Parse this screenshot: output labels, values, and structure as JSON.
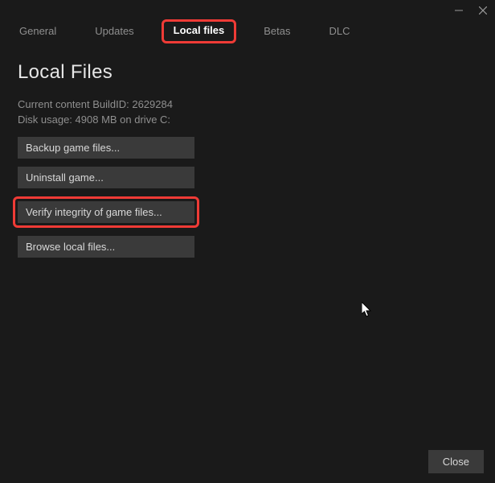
{
  "window": {
    "minimize_icon": "minimize-icon",
    "close_icon": "close-icon"
  },
  "tabs": {
    "general": "General",
    "updates": "Updates",
    "local_files": "Local files",
    "betas": "Betas",
    "dlc": "DLC"
  },
  "page": {
    "title": "Local Files",
    "build_line": "Current content BuildID: 2629284",
    "disk_line": "Disk usage: 4908 MB on drive C:"
  },
  "buttons": {
    "backup": "Backup game files...",
    "uninstall": "Uninstall game...",
    "verify": "Verify integrity of game files...",
    "browse": "Browse local files..."
  },
  "footer": {
    "close": "Close"
  }
}
